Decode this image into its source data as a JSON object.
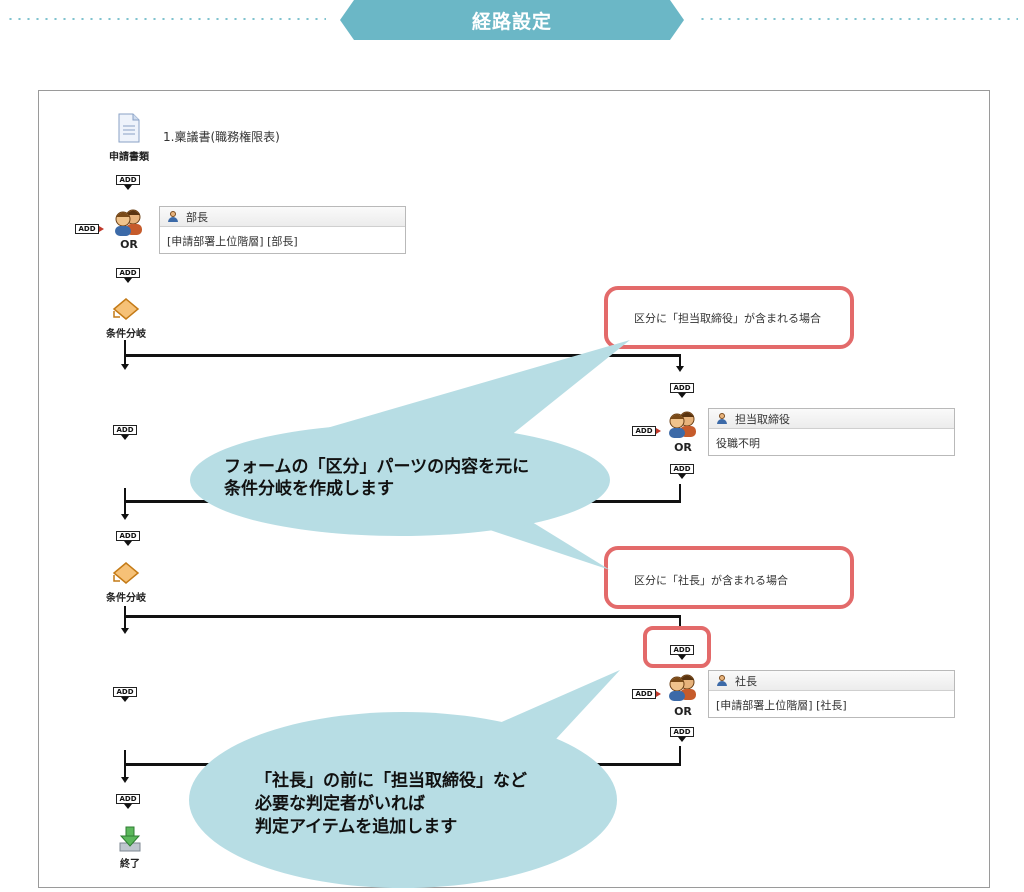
{
  "header": {
    "title": "経路設定"
  },
  "document": {
    "icon_label": "申請書類",
    "name": "1.稟議書(職務権限表)"
  },
  "add_label": "ADD",
  "or_label": "OR",
  "approver1": {
    "title": "部長",
    "body": "[申請部署上位階層] [部長]"
  },
  "branch1": {
    "label": "条件分岐",
    "condition": "区分に「担当取締役」が含まれる場合"
  },
  "approver2": {
    "title": "担当取締役",
    "body": "役職不明"
  },
  "branch2": {
    "label": "条件分岐",
    "condition": "区分に「社長」が含まれる場合"
  },
  "approver3": {
    "title": "社長",
    "body": "[申請部署上位階層] [社長]"
  },
  "end_label": "終了",
  "callout1": {
    "line1": "フォームの「区分」パーツの内容を元に",
    "line2": "条件分岐を作成します"
  },
  "callout2": {
    "line1": "「社長」の前に「担当取締役」など",
    "line2": "必要な判定者がいれば",
    "line3": "判定アイテムを追加します"
  },
  "colors": {
    "banner": "#6bb7c6",
    "highlight": "#e36a6a",
    "bubble": "#b7dde4"
  }
}
